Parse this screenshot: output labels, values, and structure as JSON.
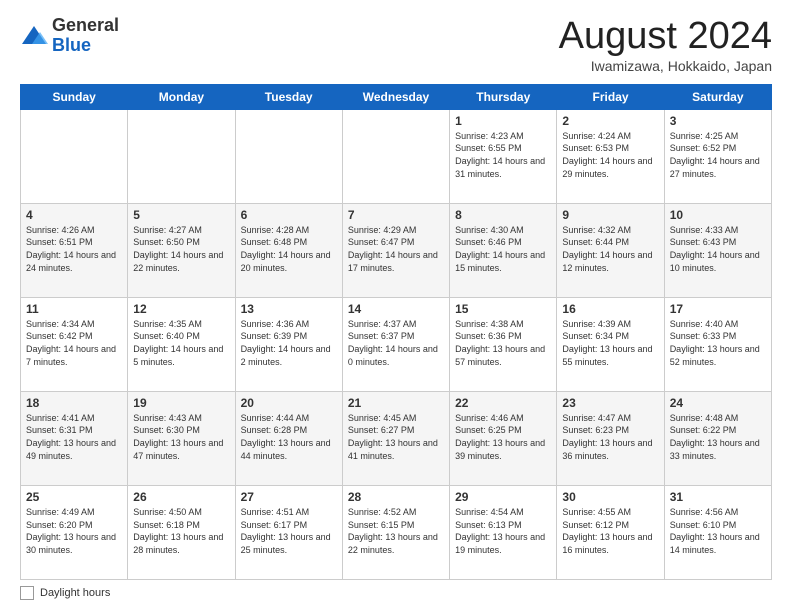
{
  "header": {
    "logo_general": "General",
    "logo_blue": "Blue",
    "month_title": "August 2024",
    "location": "Iwamizawa, Hokkaido, Japan"
  },
  "days_of_week": [
    "Sunday",
    "Monday",
    "Tuesday",
    "Wednesday",
    "Thursday",
    "Friday",
    "Saturday"
  ],
  "weeks": [
    [
      {
        "day": "",
        "info": ""
      },
      {
        "day": "",
        "info": ""
      },
      {
        "day": "",
        "info": ""
      },
      {
        "day": "",
        "info": ""
      },
      {
        "day": "1",
        "info": "Sunrise: 4:23 AM\nSunset: 6:55 PM\nDaylight: 14 hours and 31 minutes."
      },
      {
        "day": "2",
        "info": "Sunrise: 4:24 AM\nSunset: 6:53 PM\nDaylight: 14 hours and 29 minutes."
      },
      {
        "day": "3",
        "info": "Sunrise: 4:25 AM\nSunset: 6:52 PM\nDaylight: 14 hours and 27 minutes."
      }
    ],
    [
      {
        "day": "4",
        "info": "Sunrise: 4:26 AM\nSunset: 6:51 PM\nDaylight: 14 hours and 24 minutes."
      },
      {
        "day": "5",
        "info": "Sunrise: 4:27 AM\nSunset: 6:50 PM\nDaylight: 14 hours and 22 minutes."
      },
      {
        "day": "6",
        "info": "Sunrise: 4:28 AM\nSunset: 6:48 PM\nDaylight: 14 hours and 20 minutes."
      },
      {
        "day": "7",
        "info": "Sunrise: 4:29 AM\nSunset: 6:47 PM\nDaylight: 14 hours and 17 minutes."
      },
      {
        "day": "8",
        "info": "Sunrise: 4:30 AM\nSunset: 6:46 PM\nDaylight: 14 hours and 15 minutes."
      },
      {
        "day": "9",
        "info": "Sunrise: 4:32 AM\nSunset: 6:44 PM\nDaylight: 14 hours and 12 minutes."
      },
      {
        "day": "10",
        "info": "Sunrise: 4:33 AM\nSunset: 6:43 PM\nDaylight: 14 hours and 10 minutes."
      }
    ],
    [
      {
        "day": "11",
        "info": "Sunrise: 4:34 AM\nSunset: 6:42 PM\nDaylight: 14 hours and 7 minutes."
      },
      {
        "day": "12",
        "info": "Sunrise: 4:35 AM\nSunset: 6:40 PM\nDaylight: 14 hours and 5 minutes."
      },
      {
        "day": "13",
        "info": "Sunrise: 4:36 AM\nSunset: 6:39 PM\nDaylight: 14 hours and 2 minutes."
      },
      {
        "day": "14",
        "info": "Sunrise: 4:37 AM\nSunset: 6:37 PM\nDaylight: 14 hours and 0 minutes."
      },
      {
        "day": "15",
        "info": "Sunrise: 4:38 AM\nSunset: 6:36 PM\nDaylight: 13 hours and 57 minutes."
      },
      {
        "day": "16",
        "info": "Sunrise: 4:39 AM\nSunset: 6:34 PM\nDaylight: 13 hours and 55 minutes."
      },
      {
        "day": "17",
        "info": "Sunrise: 4:40 AM\nSunset: 6:33 PM\nDaylight: 13 hours and 52 minutes."
      }
    ],
    [
      {
        "day": "18",
        "info": "Sunrise: 4:41 AM\nSunset: 6:31 PM\nDaylight: 13 hours and 49 minutes."
      },
      {
        "day": "19",
        "info": "Sunrise: 4:43 AM\nSunset: 6:30 PM\nDaylight: 13 hours and 47 minutes."
      },
      {
        "day": "20",
        "info": "Sunrise: 4:44 AM\nSunset: 6:28 PM\nDaylight: 13 hours and 44 minutes."
      },
      {
        "day": "21",
        "info": "Sunrise: 4:45 AM\nSunset: 6:27 PM\nDaylight: 13 hours and 41 minutes."
      },
      {
        "day": "22",
        "info": "Sunrise: 4:46 AM\nSunset: 6:25 PM\nDaylight: 13 hours and 39 minutes."
      },
      {
        "day": "23",
        "info": "Sunrise: 4:47 AM\nSunset: 6:23 PM\nDaylight: 13 hours and 36 minutes."
      },
      {
        "day": "24",
        "info": "Sunrise: 4:48 AM\nSunset: 6:22 PM\nDaylight: 13 hours and 33 minutes."
      }
    ],
    [
      {
        "day": "25",
        "info": "Sunrise: 4:49 AM\nSunset: 6:20 PM\nDaylight: 13 hours and 30 minutes."
      },
      {
        "day": "26",
        "info": "Sunrise: 4:50 AM\nSunset: 6:18 PM\nDaylight: 13 hours and 28 minutes."
      },
      {
        "day": "27",
        "info": "Sunrise: 4:51 AM\nSunset: 6:17 PM\nDaylight: 13 hours and 25 minutes."
      },
      {
        "day": "28",
        "info": "Sunrise: 4:52 AM\nSunset: 6:15 PM\nDaylight: 13 hours and 22 minutes."
      },
      {
        "day": "29",
        "info": "Sunrise: 4:54 AM\nSunset: 6:13 PM\nDaylight: 13 hours and 19 minutes."
      },
      {
        "day": "30",
        "info": "Sunrise: 4:55 AM\nSunset: 6:12 PM\nDaylight: 13 hours and 16 minutes."
      },
      {
        "day": "31",
        "info": "Sunrise: 4:56 AM\nSunset: 6:10 PM\nDaylight: 13 hours and 14 minutes."
      }
    ]
  ],
  "footer": {
    "legend_label": "Daylight hours"
  }
}
